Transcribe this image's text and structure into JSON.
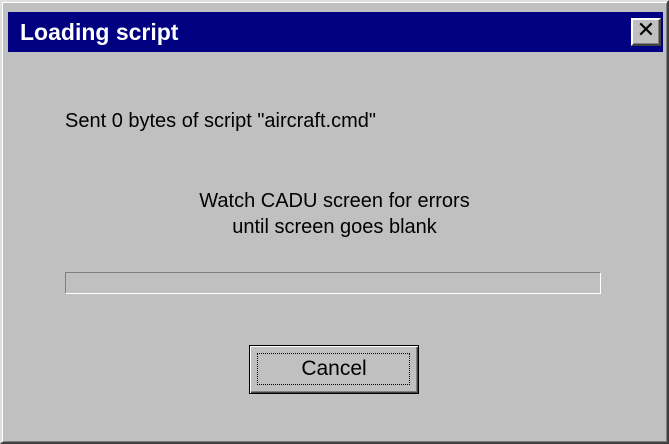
{
  "window": {
    "title": "Loading script",
    "close_icon": "close-icon",
    "close_glyph": "✕"
  },
  "message": {
    "sent": "Sent 0 bytes of script \"aircraft.cmd\"",
    "watch_line1": "Watch CADU screen for errors",
    "watch_line2": "until screen goes blank"
  },
  "progress": {
    "value": 0
  },
  "buttons": {
    "cancel_label": "Cancel"
  },
  "colors": {
    "titlebar": "#000080",
    "face": "#c0c0c0",
    "title_text": "#ffffff"
  }
}
